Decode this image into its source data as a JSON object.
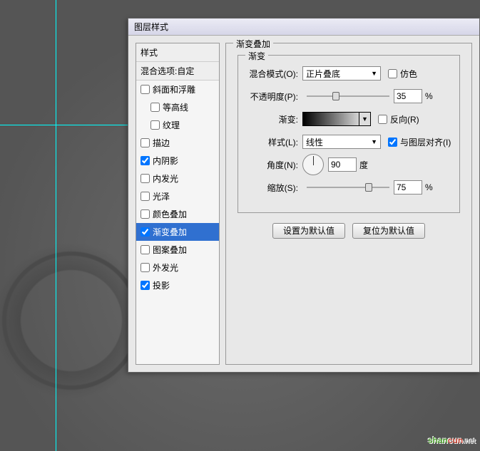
{
  "dialog": {
    "title": "图层样式"
  },
  "styles": {
    "header": "样式",
    "blend_options": "混合选项:自定",
    "items": [
      {
        "label": "斜面和浮雕",
        "checked": false,
        "indent": false
      },
      {
        "label": "等高线",
        "checked": false,
        "indent": true
      },
      {
        "label": "纹理",
        "checked": false,
        "indent": true
      },
      {
        "label": "描边",
        "checked": false,
        "indent": false
      },
      {
        "label": "内阴影",
        "checked": true,
        "indent": false
      },
      {
        "label": "内发光",
        "checked": false,
        "indent": false
      },
      {
        "label": "光泽",
        "checked": false,
        "indent": false
      },
      {
        "label": "颜色叠加",
        "checked": false,
        "indent": false
      },
      {
        "label": "渐变叠加",
        "checked": true,
        "indent": false,
        "selected": true
      },
      {
        "label": "图案叠加",
        "checked": false,
        "indent": false
      },
      {
        "label": "外发光",
        "checked": false,
        "indent": false
      },
      {
        "label": "投影",
        "checked": true,
        "indent": false
      }
    ]
  },
  "panel": {
    "title": "渐变叠加",
    "group_title": "渐变",
    "blend_mode_label": "混合模式(O):",
    "blend_mode_value": "正片叠底",
    "dither_label": "仿色",
    "dither_checked": false,
    "opacity_label": "不透明度(P):",
    "opacity_value": "35",
    "opacity_unit": "%",
    "gradient_label": "渐变:",
    "reverse_label": "反向(R)",
    "reverse_checked": false,
    "style_label": "样式(L):",
    "style_value": "线性",
    "align_label": "与图层对齐(I)",
    "align_checked": true,
    "angle_label": "角度(N):",
    "angle_value": "90",
    "angle_unit": "度",
    "scale_label": "缩放(S):",
    "scale_value": "75",
    "scale_unit": "%",
    "btn_default": "设置为默认值",
    "btn_reset": "复位为默认值"
  },
  "watermark": {
    "a": "shan",
    "b": "cun",
    "c": ".net"
  }
}
